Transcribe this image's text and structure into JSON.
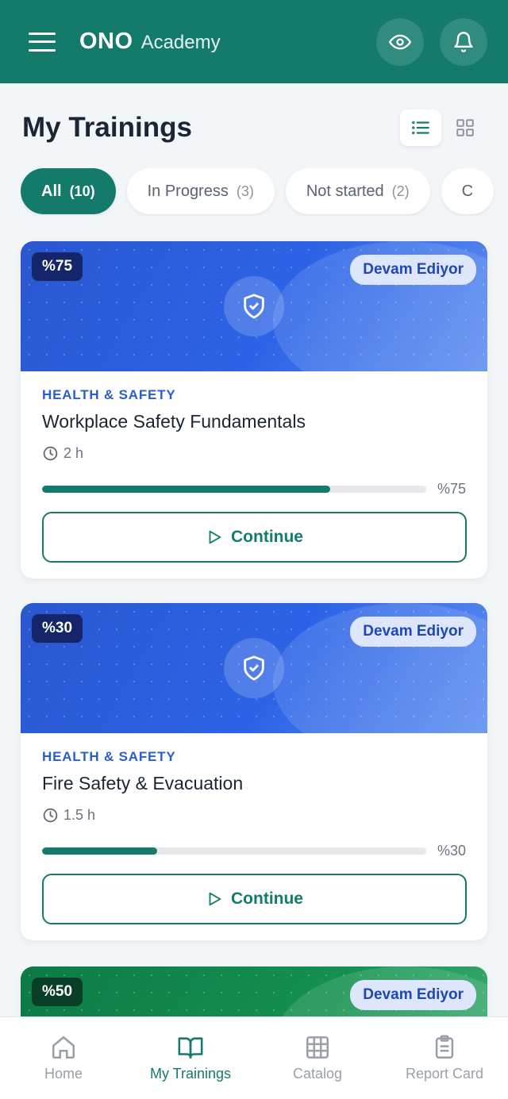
{
  "header": {
    "brand_bold": "ONO",
    "brand_light": "Academy",
    "menu_icon": "hamburger-icon",
    "actions": [
      "eye-icon",
      "bell-icon"
    ]
  },
  "page": {
    "title": "My Trainings",
    "view_modes": [
      "list-view-icon",
      "grid-view-icon"
    ],
    "active_view": "list"
  },
  "filters": [
    {
      "label": "All",
      "count": "(10)",
      "active": true
    },
    {
      "label": "In Progress",
      "count": "(3)",
      "active": false
    },
    {
      "label": "Not started",
      "count": "(2)",
      "active": false
    },
    {
      "label": "C",
      "count": "",
      "active": false
    }
  ],
  "courses": [
    {
      "percent_badge": "%75",
      "status": "Devam Ediyor",
      "category": "HEALTH & SAFETY",
      "title": "Workplace Safety Fundamentals",
      "duration": "2 h",
      "progress": 0.75,
      "progress_label": "%75",
      "button": "Continue",
      "banner_color": "#2c63e6",
      "banner_icon": "shield-check-icon"
    },
    {
      "percent_badge": "%30",
      "status": "Devam Ediyor",
      "category": "HEALTH & SAFETY",
      "title": "Fire Safety & Evacuation",
      "duration": "1.5 h",
      "progress": 0.3,
      "progress_label": "%30",
      "button": "Continue",
      "banner_color": "#2c63e6",
      "banner_icon": "shield-check-icon"
    },
    {
      "percent_badge": "%50",
      "status": "Devam Ediyor",
      "banner_color": "#14904f"
    }
  ],
  "bottom_nav": [
    {
      "label": "Home",
      "icon": "home-icon",
      "active": false
    },
    {
      "label": "My Trainings",
      "icon": "book-open-icon",
      "active": true
    },
    {
      "label": "Catalog",
      "icon": "grid-icon",
      "active": false
    },
    {
      "label": "Report Card",
      "icon": "clipboard-icon",
      "active": false
    }
  ],
  "colors": {
    "primary": "#137a6c",
    "background": "#f3f6f9",
    "category_blue": "#2a5ed0"
  }
}
